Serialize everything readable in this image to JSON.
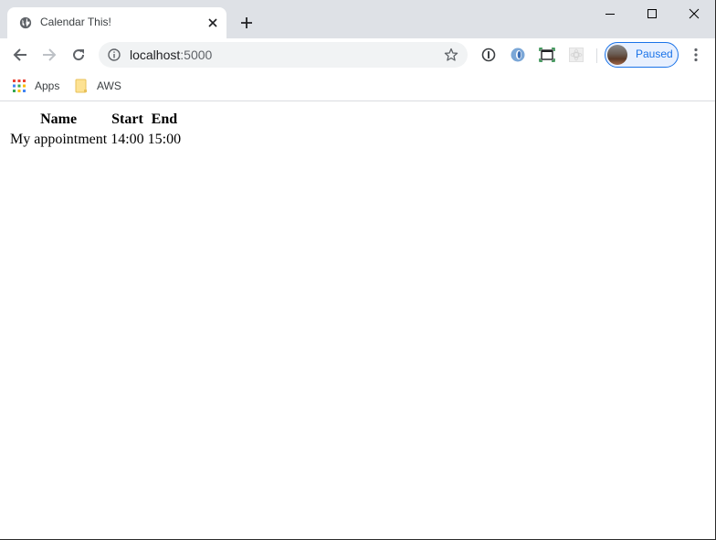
{
  "browser": {
    "tab": {
      "title": "Calendar This!",
      "favicon": "globe-icon"
    },
    "new_tab_icon": "plus-icon",
    "window_controls": [
      "minimize-icon",
      "maximize-icon",
      "close-icon"
    ],
    "toolbar": {
      "back_icon": "arrow-left-icon",
      "forward_icon": "arrow-right-icon",
      "reload_icon": "reload-icon",
      "url_host": "localhost",
      "url_port": ":5000",
      "info_icon": "info-icon",
      "bookmark_star_icon": "star-icon",
      "extensions": [
        "1password-icon",
        "extension-blue-icon",
        "screenshot-icon",
        "extension-grey-icon"
      ],
      "profile_label": "Paused",
      "menu_icon": "more-vert-icon"
    },
    "bookmarks": [
      {
        "label": "Apps",
        "icon": "apps-grid-icon"
      },
      {
        "label": "AWS",
        "icon": "folder-icon"
      }
    ]
  },
  "page": {
    "table": {
      "headers": [
        "Name",
        "Start",
        "End"
      ],
      "rows": [
        [
          "My appointment",
          "14:00",
          "15:00"
        ]
      ]
    }
  },
  "colors": {
    "accent": "#1a73e8",
    "tabstrip_bg": "#dee1e6",
    "omnibox_bg": "#f1f3f4"
  }
}
